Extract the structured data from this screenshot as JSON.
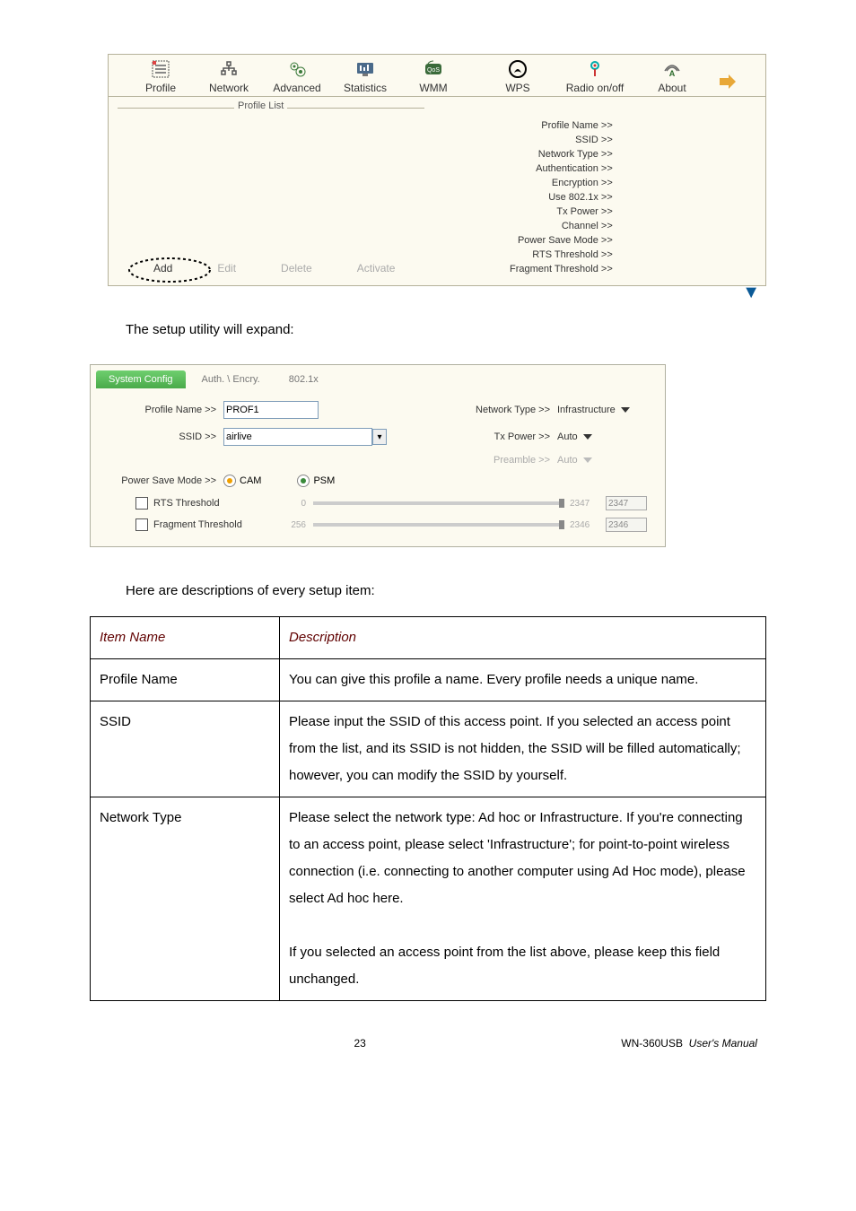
{
  "toolbar": {
    "profile": "Profile",
    "network": "Network",
    "advanced": "Advanced",
    "statistics": "Statistics",
    "wmm": "WMM",
    "wps": "WPS",
    "radio": "Radio on/off",
    "about": "About"
  },
  "profile_panel": {
    "list_label": "Profile List",
    "info": {
      "profile_name": "Profile Name >>",
      "ssid": "SSID >>",
      "network_type": "Network Type >>",
      "authentication": "Authentication >>",
      "encryption": "Encryption >>",
      "use_8021x": "Use 802.1x >>",
      "tx_power": "Tx Power >>",
      "channel": "Channel >>",
      "power_save": "Power Save Mode >>",
      "rts": "RTS Threshold >>",
      "fragment": "Fragment Threshold >>"
    },
    "buttons": {
      "add": "Add",
      "edit": "Edit",
      "delete": "Delete",
      "activate": "Activate"
    }
  },
  "text1": "The setup utility will expand:",
  "sysconfig": {
    "tabs": {
      "system": "System Config",
      "auth": "Auth. \\ Encry.",
      "dot1x": "802.1x"
    },
    "profile_name_lbl": "Profile Name >>",
    "profile_name_val": "PROF1",
    "ssid_lbl": "SSID >>",
    "ssid_val": "airlive",
    "network_type_lbl": "Network Type >>",
    "network_type_val": "Infrastructure",
    "tx_power_lbl": "Tx Power >>",
    "tx_power_val": "Auto",
    "preamble_lbl": "Preamble >>",
    "preamble_val": "Auto",
    "psm_lbl": "Power Save Mode >>",
    "psm_cam": "CAM",
    "psm_psm": "PSM",
    "rts_label": "RTS Threshold",
    "rts_min": "0",
    "rts_max": "2347",
    "rts_val": "2347",
    "frag_label": "Fragment Threshold",
    "frag_min": "256",
    "frag_max": "2346",
    "frag_val": "2346"
  },
  "text2": "Here are descriptions of every setup item:",
  "table": {
    "h1": "Item Name",
    "h2": "Description",
    "rows": [
      {
        "item": "Profile Name",
        "desc": "You can give this profile a name. Every profile needs a unique name."
      },
      {
        "item": "SSID",
        "desc": "Please input the SSID of this access point. If you selected an access point from the list, and its SSID is not hidden, the SSID will be filled automatically; however, you can modify the SSID by yourself."
      },
      {
        "item": "Network Type",
        "desc": "Please select the network type: Ad hoc or Infrastructure. If you're connecting to an access point, please select 'Infrastructure'; for point-to-point wireless connection (i.e. connecting to another computer using Ad Hoc mode), please select Ad hoc here.\n\nIf you selected an access point from the list above, please keep this field unchanged."
      }
    ]
  },
  "footer": {
    "page": "23",
    "model": "WN-360USB",
    "title": "User's Manual"
  }
}
